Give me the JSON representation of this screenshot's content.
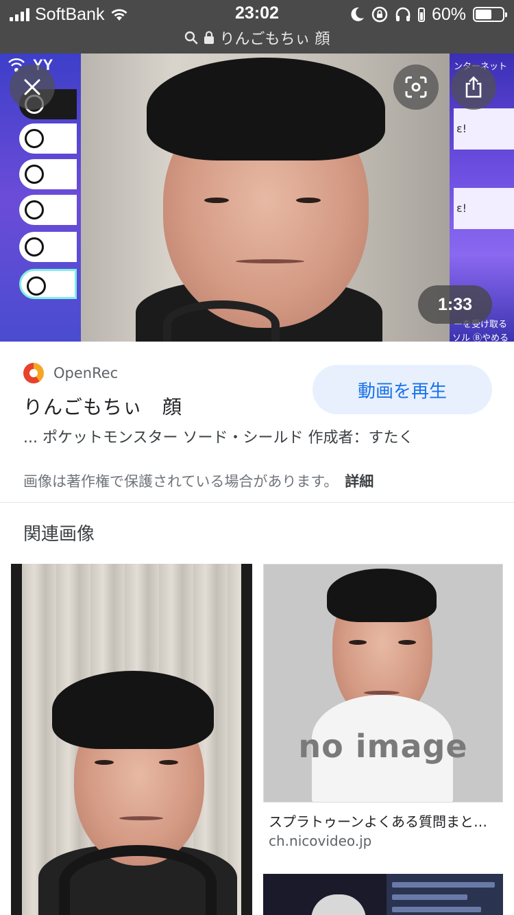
{
  "status_bar": {
    "carrier": "SoftBank",
    "time": "23:02",
    "battery_percent": "60%",
    "battery_level": 0.6,
    "icons": [
      "signal-icon",
      "wifi-icon",
      "moon-icon",
      "rotation-lock-icon",
      "headphones-icon",
      "battery-icon"
    ]
  },
  "url_bar": {
    "text": "りんごもちぃ 顔",
    "icons": [
      "search-icon",
      "lock-icon"
    ]
  },
  "viewer": {
    "close_icon": "close-icon",
    "lens_icon": "lens-icon",
    "share_icon": "share-icon",
    "duration": "1:33",
    "game_overlay_texts": {
      "left_brand": "YY",
      "right_top": "ンターネット",
      "right_line1": "ε!",
      "right_line2": "ε!",
      "right_receive": "ーを受け取る",
      "right_bottom": "ソル Ⓑやめる"
    }
  },
  "result": {
    "source": "OpenRec",
    "title": "りんごもちぃ　顔",
    "play_button": "動画を再生",
    "description": "... ポケットモンスター ソード・シールド 作成者：すたく",
    "copyright": "画像は著作権で保護されている場合があります。",
    "details_link": "詳細"
  },
  "related": {
    "heading": "関連画像",
    "items": [
      {
        "caption": "",
        "domain": ""
      },
      {
        "overlay_text": "no image",
        "caption": "スプラトゥーンよくある質問まと…",
        "domain": "ch.nicovideo.jp"
      },
      {
        "caption": "",
        "domain": ""
      }
    ]
  },
  "colors": {
    "status_bg": "#4a4a4a",
    "play_button_bg": "#e8f0fe",
    "play_button_text": "#1a73e8",
    "game_purple": "#5b48d6"
  }
}
